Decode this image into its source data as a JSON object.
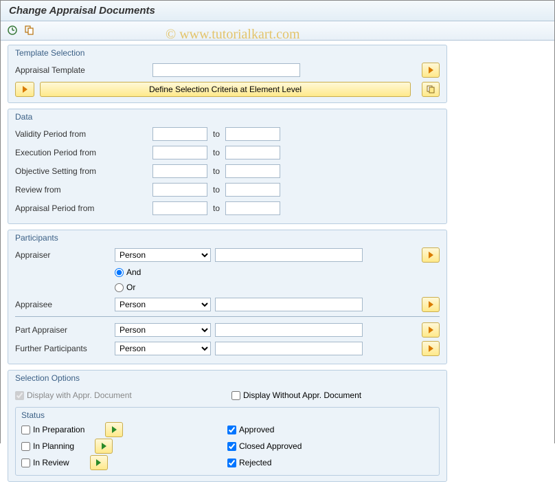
{
  "title": "Change Appraisal Documents",
  "watermark": "© www.tutorialkart.com",
  "template_selection": {
    "title": "Template Selection",
    "appraisal_template_label": "Appraisal Template",
    "appraisal_template_value": "",
    "criteria_button": "Define Selection Criteria at Element Level"
  },
  "data": {
    "title": "Data",
    "to_label": "to",
    "rows": [
      {
        "label": "Validity Period from",
        "from": "",
        "to": ""
      },
      {
        "label": "Execution Period from",
        "from": "",
        "to": ""
      },
      {
        "label": "Objective Setting from",
        "from": "",
        "to": ""
      },
      {
        "label": "Review from",
        "from": "",
        "to": ""
      },
      {
        "label": "Appraisal Period from",
        "from": "",
        "to": ""
      }
    ]
  },
  "participants": {
    "title": "Participants",
    "and_label": "And",
    "or_label": "Or",
    "radio_selected": "and",
    "rows": [
      {
        "key": "appraiser",
        "label": "Appraiser",
        "type": "Person",
        "value": ""
      },
      {
        "key": "appraisee",
        "label": "Appraisee",
        "type": "Person",
        "value": ""
      },
      {
        "key": "part_appraiser",
        "label": "Part Appraiser",
        "type": "Person",
        "value": ""
      },
      {
        "key": "further",
        "label": "Further Participants",
        "type": "Person",
        "value": ""
      }
    ],
    "type_options": [
      "Person"
    ]
  },
  "selection_options": {
    "title": "Selection Options",
    "display_with_label": "Display with Appr. Document",
    "display_with_checked": true,
    "display_with_disabled": true,
    "display_without_label": "Display Without Appr. Document",
    "display_without_checked": false,
    "status": {
      "title": "Status",
      "left": [
        {
          "label": "In Preparation",
          "checked": false
        },
        {
          "label": "In Planning",
          "checked": false
        },
        {
          "label": "In Review",
          "checked": false
        }
      ],
      "right": [
        {
          "label": "Approved",
          "checked": true
        },
        {
          "label": "Closed Approved",
          "checked": true
        },
        {
          "label": "Rejected",
          "checked": true
        }
      ]
    }
  }
}
